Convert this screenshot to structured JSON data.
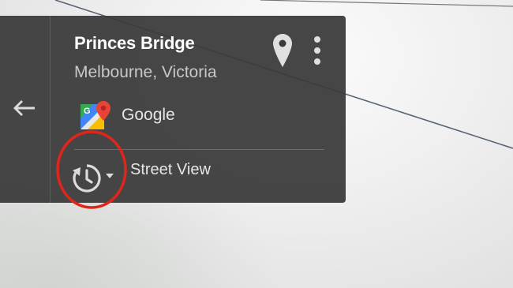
{
  "place": {
    "name": "Princes Bridge",
    "location": "Melbourne, Victoria"
  },
  "provider": {
    "name": "Google",
    "logo_icon": "google-maps-logo-icon"
  },
  "viewer": {
    "mode_label": "Street View",
    "time_icon": "history-icon",
    "dropdown_icon": "caret-down-icon"
  },
  "icons": {
    "back": "arrow-left-icon",
    "pin": "location-pin-icon",
    "more": "more-vertical-icon"
  },
  "colors": {
    "panel_bg": "#3a3a3a",
    "highlight_ring": "#e0261b",
    "maps_green": "#34a853",
    "maps_blue": "#4285f4",
    "maps_yellow": "#fbbc04",
    "maps_red": "#ea4335"
  }
}
